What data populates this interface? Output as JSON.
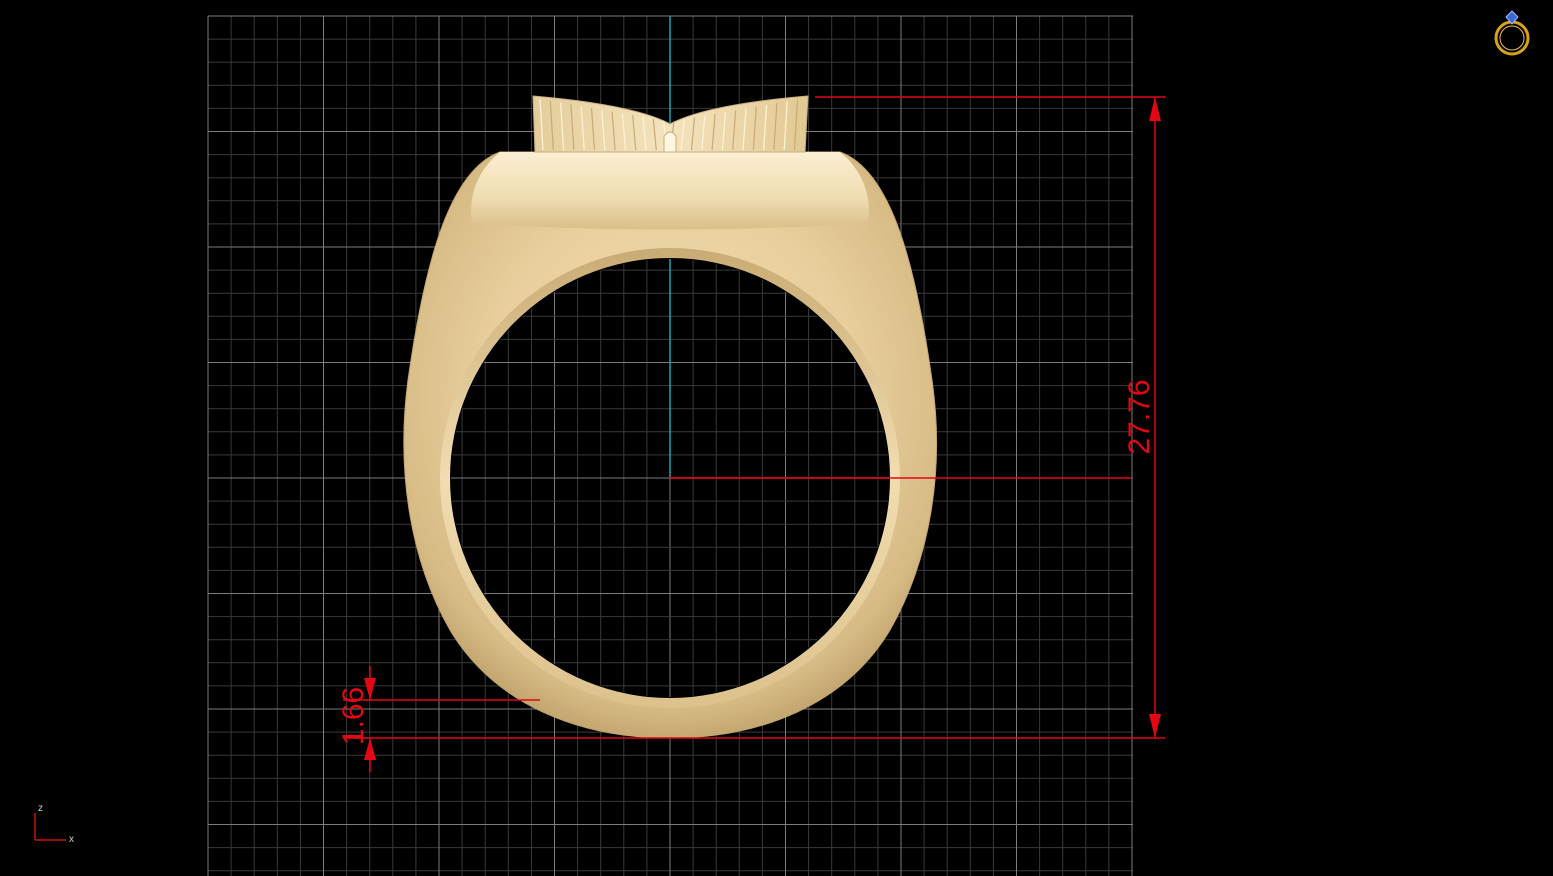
{
  "viewport": {
    "background": "#000000",
    "view": "front"
  },
  "grid": {
    "minor_color": "#3a3a3a",
    "major_color": "#7d7d7d",
    "center_line_color": "#17a6b5"
  },
  "model": {
    "name": "ring",
    "metal_color": "#e8cf9d",
    "metal_shadow": "#a88c5a",
    "metal_highlight": "#fbefd3"
  },
  "dimensions": {
    "color": "#e30613",
    "total_height_label": "27.76",
    "bottom_thickness_label": "1.66"
  },
  "axis_indicator": {
    "vertical_label": "z",
    "horizontal_label": "x",
    "color": "#cc1111"
  },
  "corner_icon": {
    "name": "ring-logo-icon",
    "ring_color": "#d9a21b",
    "gem_color": "#3a6ad6"
  }
}
